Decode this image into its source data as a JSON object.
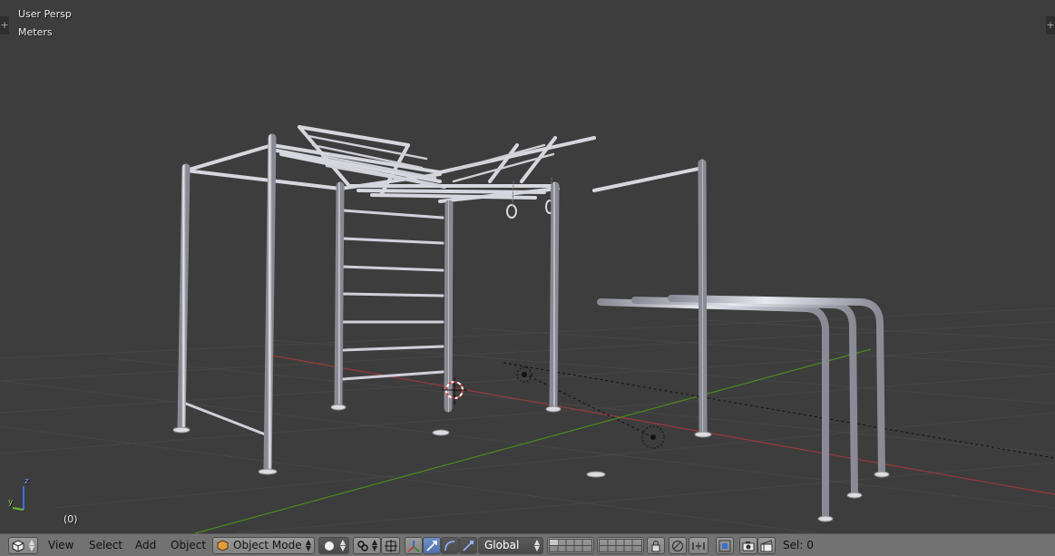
{
  "viewport": {
    "view_label": "User Persp",
    "units_label": "Meters",
    "frame_label": "(0)",
    "axis_labels": {
      "z": "z",
      "y": "y"
    }
  },
  "header": {
    "editor_icon": "3d-view-cube-icon",
    "menus": {
      "view": "View",
      "select": "Select",
      "add": "Add",
      "object": "Object"
    },
    "mode": {
      "icon": "object-cube-icon",
      "label": "Object Mode"
    },
    "shading_icon": "solid-sphere-icon",
    "pivot_icon": "pivot-point-icon",
    "orientation": "Global",
    "status": "Sel: 0"
  },
  "colors": {
    "viewport_bg": "#3d3d3d",
    "grid": "#474747",
    "x_axis": "#9a3a3a",
    "y_axis": "#4b8a1e",
    "model": "#c7c7cf",
    "header_bg": "#727272"
  }
}
